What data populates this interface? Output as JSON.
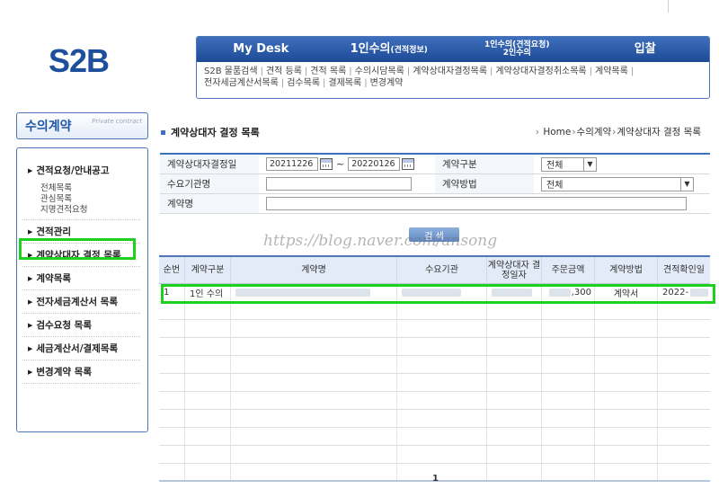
{
  "logo": "S2B",
  "topnav": {
    "tabs": [
      {
        "main": "My Desk",
        "sub": ""
      },
      {
        "main": "1인수의",
        "sub": "(견적정보)"
      },
      {
        "line1": "1인수의(견적요청)",
        "line2": "2인수의"
      },
      {
        "main": "입찰",
        "sub": ""
      }
    ],
    "links": [
      "S2B 물품검색",
      "견적 등록",
      "견적 목록",
      "수의시담목록",
      "계약상대자결정목록",
      "계약상대자결정취소목록",
      "계약목록",
      "전자세금계산서목록",
      "검수목록",
      "결제목록",
      "변경계약"
    ]
  },
  "sidebar": {
    "title": "수의계약",
    "subtitle": "Private contract",
    "items": [
      {
        "label": "견적요청/안내공고",
        "sub": [
          "전체목록",
          "관심목록",
          "지명견적요청"
        ]
      },
      {
        "label": "견적관리",
        "sub": []
      },
      {
        "label": "계약상대자 결정 목록",
        "sub": []
      },
      {
        "label": "계약목록",
        "sub": []
      },
      {
        "label": "전자세금계산서 목록",
        "sub": []
      },
      {
        "label": "검수요청 목록",
        "sub": []
      },
      {
        "label": "세금계산서/결제목록",
        "sub": []
      },
      {
        "label": "변경계약 목록",
        "sub": []
      }
    ]
  },
  "page": {
    "title": "계약상대자 결정 목록",
    "breadcrumb": [
      "Home",
      "수의계약",
      "계약상대자 결정 목록"
    ]
  },
  "form": {
    "date_label": "계약상대자결정일",
    "date_from": "20211226",
    "date_to": "20220126",
    "tilde": "~",
    "contract_type_label": "계약구분",
    "contract_type_value": "전체",
    "buyer_label": "수요기관명",
    "buyer_value": "",
    "method_label": "계약방법",
    "method_value": "전체",
    "contract_name_label": "계약명",
    "contract_name_value": "",
    "search_button": "검 색"
  },
  "watermark": "https://blog.naver.com/ansong",
  "table": {
    "headers": [
      "순번",
      "계약구분",
      "계약명",
      "수요기관",
      "계약상대자 결정일자",
      "주문금액",
      "계약방법",
      "견적확인일"
    ],
    "rows": [
      {
        "no": "1",
        "type": "1인 수의",
        "name": "",
        "buyer": "",
        "date": "",
        "amount": ",300",
        "method": "계약서",
        "confirm": "2022-"
      }
    ]
  },
  "pager": "1"
}
